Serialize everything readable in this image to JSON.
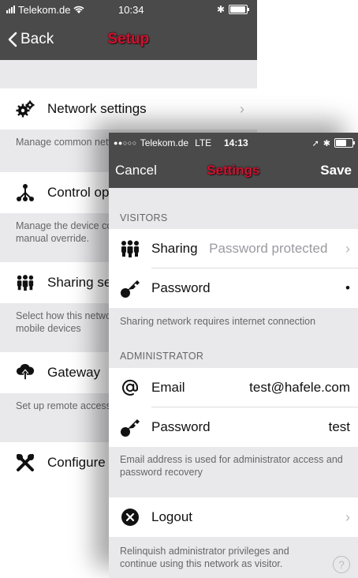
{
  "back_screen": {
    "status": {
      "carrier": "Telekom.de",
      "time": "10:34"
    },
    "nav": {
      "back_label": "Back",
      "title": "Setup"
    },
    "items": [
      {
        "label": "Network settings",
        "icon": "gears-icon",
        "description": "Manage common network settings"
      },
      {
        "label": "Control options",
        "icon": "network-tree-icon",
        "description": "Manage the device control options including manual override."
      },
      {
        "label": "Sharing settings",
        "icon": "people-group-icon",
        "description": "Select how this network can be shared with other mobile devices"
      },
      {
        "label": "Gateway",
        "icon": "cloud-upload-icon",
        "description": "Set up remote access for this device."
      },
      {
        "label": "Configure",
        "icon": "tools-icon"
      }
    ]
  },
  "front_screen": {
    "status": {
      "carrier": "Telekom.de",
      "network": "LTE",
      "time": "14:13"
    },
    "nav": {
      "cancel_label": "Cancel",
      "title": "Settings",
      "save_label": "Save"
    },
    "visitors": {
      "header": "VISITORS",
      "sharing_label": "Sharing",
      "sharing_value": "Password protected",
      "password_label": "Password",
      "password_value": "•",
      "note": "Sharing network requires internet connection"
    },
    "administrator": {
      "header": "ADMINISTRATOR",
      "email_label": "Email",
      "email_value": "test@hafele.com",
      "password_label": "Password",
      "password_value": "test",
      "note": "Email address is used for administrator access and password recovery"
    },
    "logout": {
      "label": "Logout",
      "note": "Relinquish administrator privileges and continue using this network as visitor."
    },
    "help_glyph": "?"
  }
}
